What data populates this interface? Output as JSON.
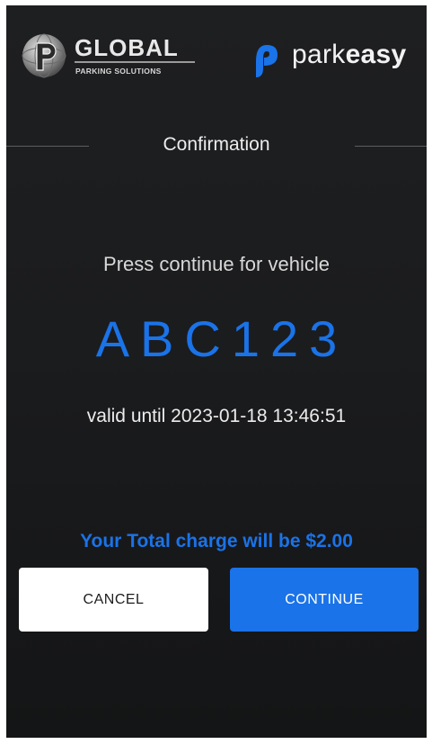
{
  "header": {
    "global_logo": {
      "name": "GLOBAL",
      "tagline": "PARKING SOLUTIONS",
      "emblem_letter": "P"
    },
    "parkeasy_logo": {
      "text_light": "park",
      "text_bold": "easy"
    }
  },
  "main": {
    "title": "Confirmation",
    "prompt": "Press continue for vehicle",
    "plate": "ABC123",
    "valid_until": "valid until 2023-01-18 13:46:51",
    "charge": "Your Total charge will be $2.00"
  },
  "actions": {
    "cancel_label": "CANCEL",
    "continue_label": "CONTINUE"
  },
  "colors": {
    "accent": "#1a73e8",
    "background": "#1b1c1e",
    "cancel_background": "#ffffff"
  },
  "icons": {
    "global_emblem": "globe-p-emblem-icon",
    "parkeasy": "parkeasy-p-icon"
  }
}
